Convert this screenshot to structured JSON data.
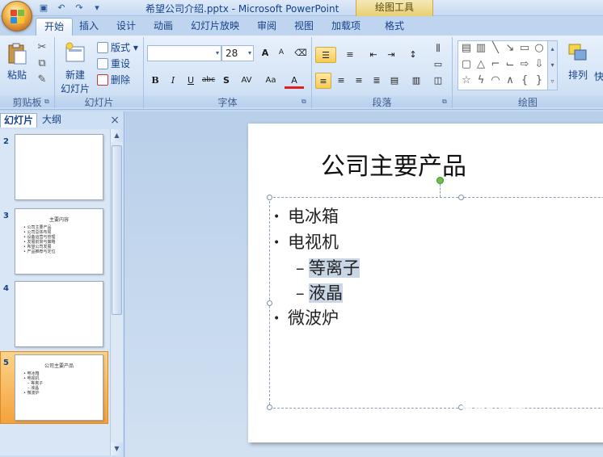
{
  "window": {
    "title": "希望公司介绍.pptx - Microsoft PowerPoint",
    "context_tool": "绘图工具"
  },
  "tabs": [
    "开始",
    "插入",
    "设计",
    "动画",
    "幻灯片放映",
    "审阅",
    "视图",
    "加载项",
    "格式"
  ],
  "ribbon": {
    "clipboard": {
      "paste": "粘贴",
      "label": "剪贴板"
    },
    "slides": {
      "new_slide_line1": "新建",
      "new_slide_line2": "幻灯片",
      "layout": "版式",
      "reset": "重设",
      "delete": "删除",
      "label": "幻灯片"
    },
    "font": {
      "size": "28",
      "grow": "A",
      "shrink": "A",
      "bold": "B",
      "italic": "I",
      "underline": "U",
      "strike": "abc",
      "shadow": "S",
      "spacing": "AV",
      "case": "Aa",
      "color": "A",
      "label": "字体"
    },
    "paragraph": {
      "label": "段落"
    },
    "drawing": {
      "arrange": "排列",
      "quick_styles": "快",
      "label": "绘图"
    }
  },
  "left_pane": {
    "tabs": [
      "幻灯片",
      "大纲"
    ],
    "close": "×",
    "thumbnails": [
      {
        "num": "2",
        "title": "",
        "items": []
      },
      {
        "num": "3",
        "title": "主要内容",
        "items": [
          "公司主要产品",
          "公司总体布局",
          "设备运营与管理",
          "发展前景与策略",
          "希望公司发展",
          "产品推荐与定位"
        ]
      },
      {
        "num": "4",
        "title": "",
        "items": []
      },
      {
        "num": "5",
        "title": "公司主要产品",
        "items": [
          "电冰箱",
          "电视机",
          "等离子",
          "液晶",
          "微波炉"
        ],
        "selected": true
      }
    ]
  },
  "slide": {
    "title": "公司主要产品",
    "bullets": [
      {
        "text": "电冰箱",
        "level": 1,
        "highlight": false
      },
      {
        "text": "电视机",
        "level": 1,
        "highlight": false
      },
      {
        "text": "等离子",
        "level": 2,
        "highlight": true
      },
      {
        "text": "液晶",
        "level": 2,
        "highlight": true
      },
      {
        "text": "微波炉",
        "level": 1,
        "highlight": false
      }
    ]
  },
  "watermark": {
    "main": "Bai 经验",
    "sub": "jingyan.baidu.com"
  }
}
